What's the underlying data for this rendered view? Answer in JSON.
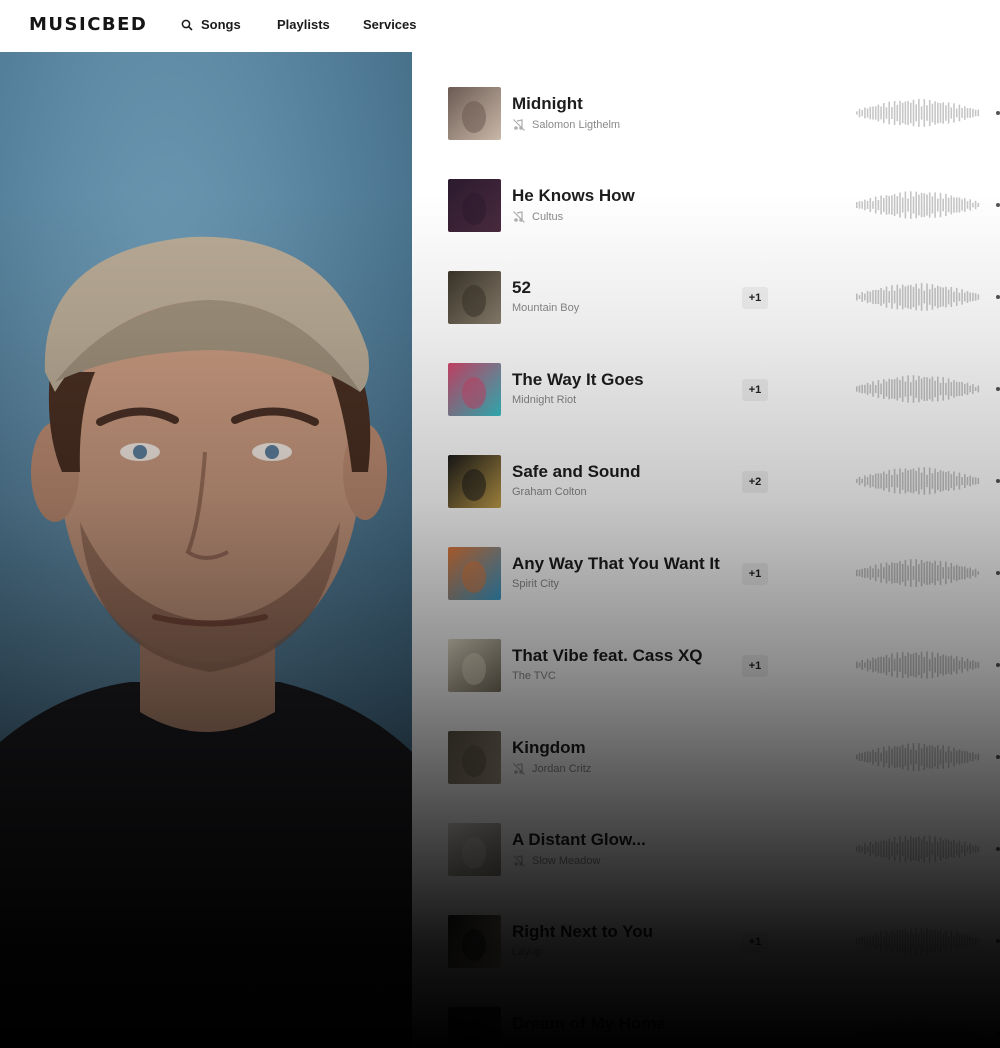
{
  "header": {
    "logo": "MUSICBED",
    "nav": {
      "songs": "Songs",
      "playlists": "Playlists",
      "services": "Services"
    }
  },
  "tracks": [
    {
      "title": "Midnight",
      "artist": "Salomon Ligthelm",
      "muted": true,
      "extra": "",
      "cover_colors": [
        "#6b5a52",
        "#c9b8a8"
      ]
    },
    {
      "title": "He Knows How",
      "artist": "Cultus",
      "muted": true,
      "extra": "",
      "cover_colors": [
        "#2b1a2e",
        "#4a2a3e"
      ]
    },
    {
      "title": "52",
      "artist": "Mountain Boy",
      "muted": false,
      "extra": "+1",
      "cover_colors": [
        "#3a3328",
        "#8a7f6e"
      ]
    },
    {
      "title": "The Way It Goes",
      "artist": "Midnight Riot",
      "muted": false,
      "extra": "+1",
      "cover_colors": [
        "#d6456b",
        "#35c2c9"
      ]
    },
    {
      "title": "Safe and Sound",
      "artist": "Graham Colton",
      "muted": false,
      "extra": "+2",
      "cover_colors": [
        "#1a1a1a",
        "#c6a24c"
      ]
    },
    {
      "title": "Any Way That You Want It",
      "artist": "Spirit City",
      "muted": false,
      "extra": "+1",
      "cover_colors": [
        "#e87b3a",
        "#3aa0d4"
      ]
    },
    {
      "title": "That Vibe feat. Cass XQ",
      "artist": "The TVC",
      "muted": false,
      "extra": "+1",
      "cover_colors": [
        "#e9e1cc",
        "#7a7362"
      ]
    },
    {
      "title": "Kingdom",
      "artist": "Jordan Critz",
      "muted": true,
      "extra": "",
      "cover_colors": [
        "#5b5446",
        "#a39681"
      ]
    },
    {
      "title": "A Distant Glow...",
      "artist": "Slow Meadow",
      "muted": true,
      "extra": "",
      "cover_colors": [
        "#d8d6d2",
        "#8c8781"
      ]
    },
    {
      "title": "Right Next to You",
      "artist": "Layup",
      "muted": false,
      "extra": "+1",
      "cover_colors": [
        "#1c1c1c",
        "#e0d2b0"
      ]
    },
    {
      "title": "Dream of My Home",
      "artist": "",
      "muted": false,
      "extra": "",
      "cover_colors": [
        "#333333",
        "#666666"
      ]
    }
  ],
  "icons": {
    "search": "search-icon",
    "mute": "music-muted-icon"
  },
  "colors": {
    "photo_background": "#5f8aa5",
    "text": "#1d1d1d",
    "artist_text": "#8a8a8a"
  }
}
